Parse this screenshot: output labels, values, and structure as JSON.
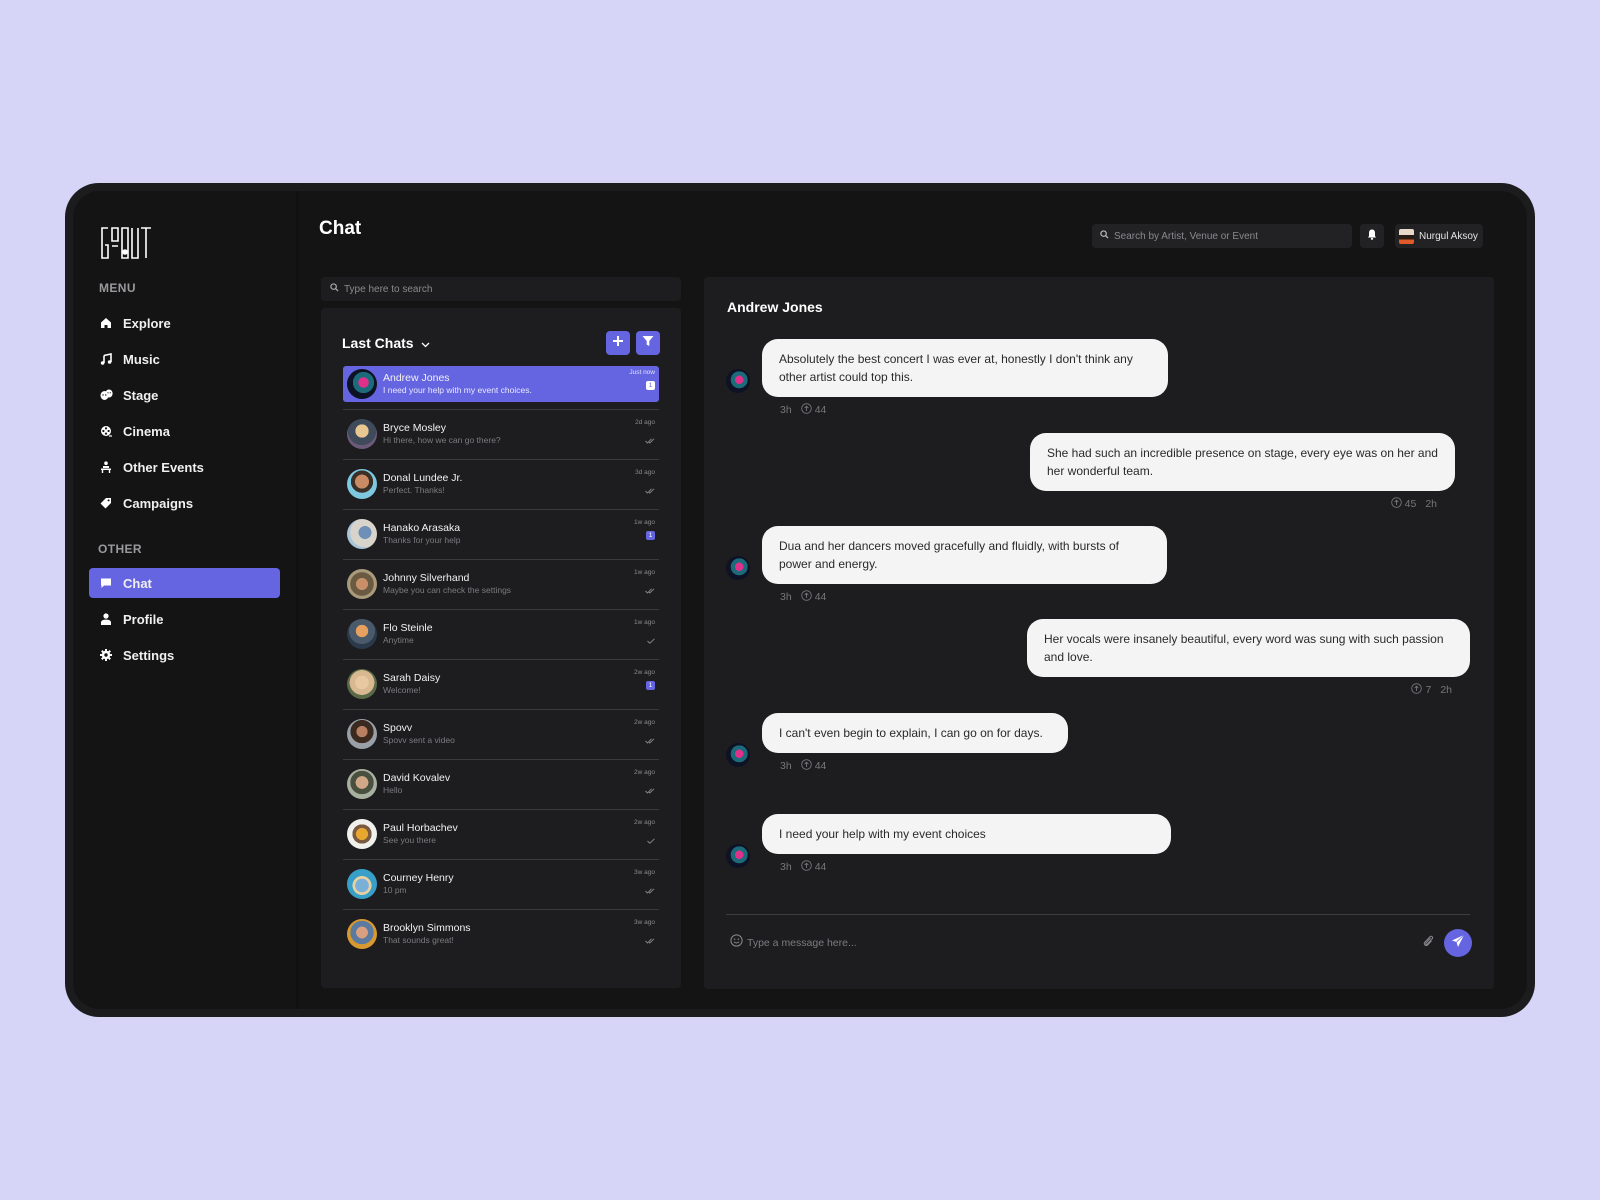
{
  "app": {
    "logo_text": "GOOUT",
    "accent_color": "#6565e1"
  },
  "sidebar": {
    "menu_label": "MENU",
    "menu_items": [
      {
        "label": "Explore",
        "icon": "home-icon"
      },
      {
        "label": "Music",
        "icon": "music-note-icon"
      },
      {
        "label": "Stage",
        "icon": "theater-masks-icon"
      },
      {
        "label": "Cinema",
        "icon": "film-reel-icon"
      },
      {
        "label": "Other Events",
        "icon": "person-at-desk-icon"
      },
      {
        "label": "Campaigns",
        "icon": "tag-icon"
      }
    ],
    "other_label": "OTHER",
    "other_items": [
      {
        "label": "Chat",
        "icon": "chat-bubble-icon",
        "active": true
      },
      {
        "label": "Profile",
        "icon": "user-icon"
      },
      {
        "label": "Settings",
        "icon": "gear-icon"
      }
    ]
  },
  "header": {
    "title": "Chat",
    "search_placeholder": "Search by Artist, Venue or Event",
    "user_name": "Nurgul Aksoy"
  },
  "chat_list": {
    "search_placeholder": "Type here to search",
    "title": "Last Chats",
    "chats": [
      {
        "name": "Andrew Jones",
        "preview": "I need your help with my event choices.",
        "time": "Just now",
        "status": "unread",
        "unread_count": "1",
        "active": true
      },
      {
        "name": "Bryce Mosley",
        "preview": "Hi there, how we can go there?",
        "time": "2d ago",
        "status": "read"
      },
      {
        "name": "Donal Lundee Jr.",
        "preview": "Perfect. Thanks!",
        "time": "3d ago",
        "status": "read"
      },
      {
        "name": "Hanako Arasaka",
        "preview": "Thanks for your help",
        "time": "1w ago",
        "status": "unread",
        "unread_count": "1"
      },
      {
        "name": "Johnny Silverhand",
        "preview": "Maybe you can check the settings",
        "time": "1w ago",
        "status": "read"
      },
      {
        "name": "Flo Steinle",
        "preview": "Anytime",
        "time": "1w ago",
        "status": "sent"
      },
      {
        "name": "Sarah Daisy",
        "preview": "Welcome!",
        "time": "2w ago",
        "status": "unread",
        "unread_count": "1"
      },
      {
        "name": "Spovv",
        "preview": "Spovv sent a video",
        "time": "2w ago",
        "status": "read"
      },
      {
        "name": "David Kovalev",
        "preview": "Hello",
        "time": "2w ago",
        "status": "read"
      },
      {
        "name": "Paul Horbachev",
        "preview": "See you there",
        "time": "2w ago",
        "status": "sent"
      },
      {
        "name": "Courney Henry",
        "preview": "10 pm",
        "time": "3w ago",
        "status": "read"
      },
      {
        "name": "Brooklyn Simmons",
        "preview": "That sounds great!",
        "time": "3w ago",
        "status": "read"
      }
    ]
  },
  "conversation": {
    "contact_name": "Andrew Jones",
    "messages": [
      {
        "direction": "in",
        "text": "Absolutely the best concert I was ever at, honestly I don't think any other artist could top this.",
        "time": "3h",
        "likes": "44"
      },
      {
        "direction": "out",
        "text": "She had such an incredible presence on stage, every eye was on her and her wonderful team.",
        "time": "2h",
        "likes": "45"
      },
      {
        "direction": "in",
        "text": "Dua and her dancers moved gracefully and fluidly, with bursts of power and energy.",
        "time": "3h",
        "likes": "44"
      },
      {
        "direction": "out",
        "text": "Her vocals were insanely beautiful, every word was sung with such passion and love.",
        "time": "2h",
        "likes": "7"
      },
      {
        "direction": "in",
        "text": "I can't even begin to explain, I can go on for days.",
        "time": "3h",
        "likes": "44"
      },
      {
        "direction": "in",
        "text": "I need your help with my event choices",
        "time": "3h",
        "likes": "44"
      }
    ],
    "composer_placeholder": "Type a message here..."
  }
}
